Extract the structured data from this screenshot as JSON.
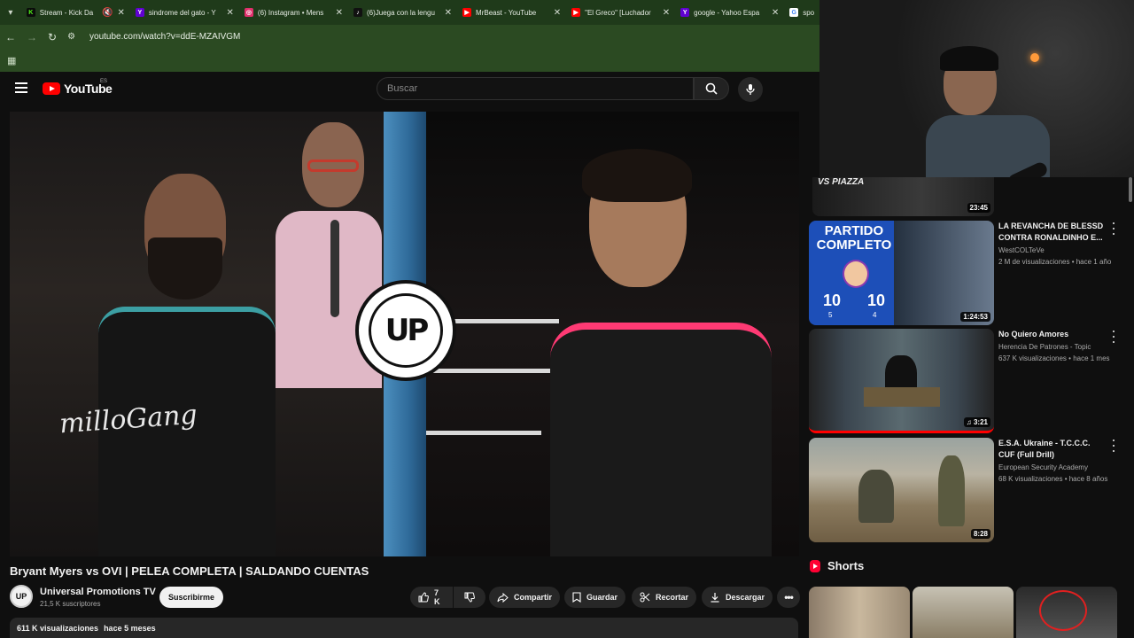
{
  "browser": {
    "tabs": [
      {
        "label": "Stream - Kick Da",
        "favicon": "K",
        "color": "#53fc18"
      },
      {
        "label": "sindrome del gato - Y",
        "favicon": "Y",
        "color": "#6001d2"
      },
      {
        "label": "(6) Instagram • Mens",
        "favicon": "◎",
        "color": "#e1306c"
      },
      {
        "label": "(6)Juega con la lengu",
        "favicon": "♪",
        "color": "#111111"
      },
      {
        "label": "MrBeast - YouTube",
        "favicon": "▶",
        "color": "#ff0000"
      },
      {
        "label": "\"El Greco\" [Luchador",
        "favicon": "▶",
        "color": "#ff0000"
      },
      {
        "label": "google - Yahoo Espa",
        "favicon": "Y",
        "color": "#6001d2"
      },
      {
        "label": "spo",
        "favicon": "G",
        "color": "#4285f4"
      }
    ],
    "url": "youtube.com/watch?v=ddE-MZAIVGM"
  },
  "header": {
    "logo_text": "YouTube",
    "country_code": "ES",
    "search_placeholder": "Buscar"
  },
  "video": {
    "title": "Bryant Myers vs OVI | PELEA COMPLETA | SALDANDO CUENTAS",
    "channel": "Universal Promotions TV",
    "channel_avatar": "UP",
    "subscribers": "21,5 K suscriptores",
    "subscribe_label": "Suscribirme",
    "likes": "7 K",
    "share_label": "Compartir",
    "save_label": "Guardar",
    "clip_label": "Recortar",
    "download_label": "Descargar",
    "views": "611 K visualizaciones",
    "age": "hace 5 meses",
    "overlay_logo": "UP"
  },
  "sidebar": {
    "partial_top": {
      "thumb_text": "VS PIAZZA",
      "duration": "23:45"
    },
    "recommendations": [
      {
        "title": "LA REVANCHA DE BLESSD CONTRA RONALDINHO E...",
        "channel": "WestCOLTeVe",
        "views": "2 M de visualizaciones",
        "age": "hace 1 año",
        "duration": "1:24:53",
        "thumb_text": "PARTIDO COMPLETO",
        "score_left": "10",
        "score_right": "10",
        "sub_left": "5",
        "sub_right": "4"
      },
      {
        "title": "No Quiero Amores",
        "channel": "Herencia De Patrones - Topic",
        "views": "637 K visualizaciones",
        "age": "hace 1 mes",
        "duration": "3:21"
      },
      {
        "title": "E.S.A. Ukraine - T.C.C.C. CUF (Full Drill)",
        "channel": "European Security Academy",
        "views": "68 K visualizaciones",
        "age": "hace 8 años",
        "duration": "8:28"
      }
    ],
    "shorts_label": "Shorts"
  },
  "colors": {
    "accent": "#ff0000",
    "chrome_tab": "#1f3a1a",
    "chrome_bar": "#2b4a22",
    "background": "#0f0f0f"
  }
}
